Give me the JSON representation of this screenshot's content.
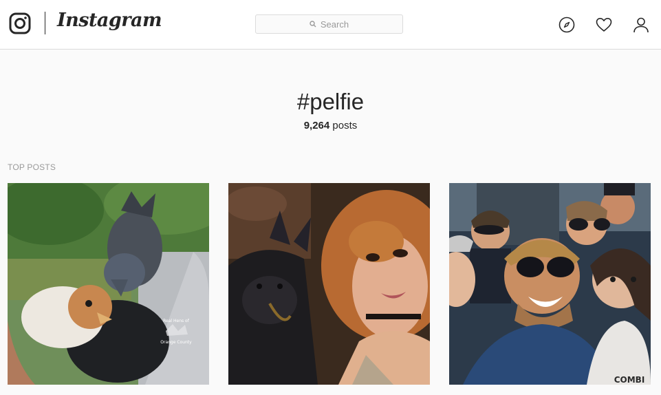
{
  "header": {
    "brand": "Instagram",
    "search": {
      "placeholder": "Search"
    },
    "icons": [
      "instagram-logo-icon",
      "compass-icon",
      "heart-icon",
      "person-icon"
    ]
  },
  "tag": {
    "name": "#pelfie",
    "post_count": "9,264",
    "post_label": "posts"
  },
  "sections": {
    "top_posts_label": "TOP POSTS"
  },
  "top_posts": [
    {
      "watermark_line1": "Real Hens of",
      "watermark_line2": "Orange County"
    },
    {},
    {
      "shirt_text": "COMBI"
    }
  ],
  "colors": {
    "background": "#fafafa",
    "header_bg": "#ffffff",
    "border": "#dbdbdb",
    "text": "#262626",
    "muted": "#999999"
  }
}
